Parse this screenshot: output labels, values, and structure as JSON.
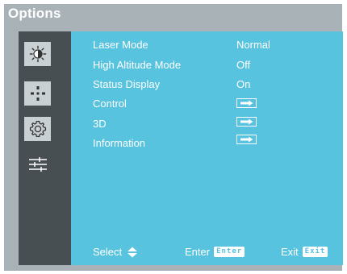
{
  "window": {
    "title": "Options"
  },
  "sidebar": {
    "items": [
      {
        "icon": "brightness-icon"
      },
      {
        "icon": "crosshair-icon"
      },
      {
        "icon": "gear-icon"
      },
      {
        "icon": "sliders-icon"
      }
    ]
  },
  "menu": {
    "items": [
      {
        "label": "Laser Mode",
        "value": "Normal"
      },
      {
        "label": "High Altitude Mode",
        "value": "Off"
      },
      {
        "label": "Status Display",
        "value": "On"
      },
      {
        "label": "Control",
        "value_icon": "right-arrow-icon"
      },
      {
        "label": "3D",
        "value_icon": "right-arrow-icon"
      },
      {
        "label": "Information",
        "value_icon": "right-arrow-icon"
      }
    ]
  },
  "footer": {
    "select_label": "Select",
    "enter_label": "Enter",
    "enter_key": "Enter",
    "exit_label": "Exit",
    "exit_key": "Exit"
  },
  "colors": {
    "frame": "#a9b3b7",
    "sidebar": "#474f53",
    "panel": "#58c3df",
    "text": "#ffffff"
  }
}
